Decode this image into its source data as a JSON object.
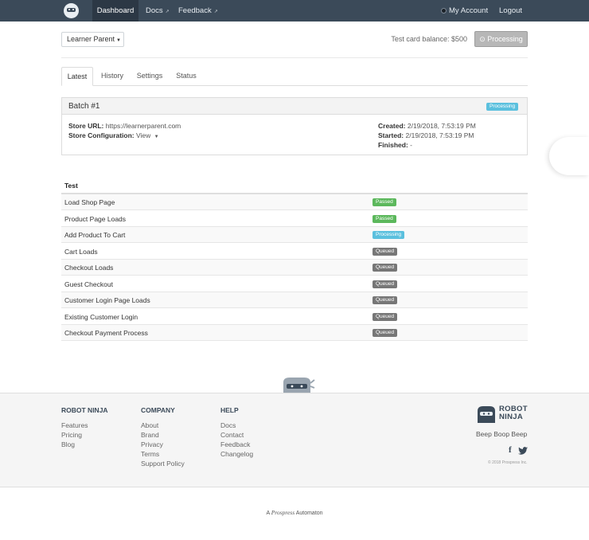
{
  "nav": {
    "items": [
      "Dashboard",
      "Docs",
      "Feedback"
    ],
    "external_marker": "↗",
    "account": "My Account",
    "logout": "Logout"
  },
  "toolbar": {
    "store": "Learner Parent",
    "balance": "Test card balance: $500",
    "status_button": "Processing"
  },
  "tabs": [
    "Latest",
    "History",
    "Settings",
    "Status"
  ],
  "batch": {
    "title": "Batch #1",
    "status": "Processing",
    "store_url_label": "Store URL:",
    "store_url": "https://learnerparent.com",
    "config_label": "Store Configuration:",
    "config_value": "View",
    "created_label": "Created:",
    "created": "2/19/2018, 7:53:19 PM",
    "started_label": "Started:",
    "started": "2/19/2018, 7:53:19 PM",
    "finished_label": "Finished:",
    "finished": "-"
  },
  "tests": {
    "header": "Test",
    "rows": [
      {
        "name": "Load Shop Page",
        "status": "Passed"
      },
      {
        "name": "Product Page Loads",
        "status": "Passed"
      },
      {
        "name": "Add Product To Cart",
        "status": "Processing"
      },
      {
        "name": "Cart Loads",
        "status": "Queued"
      },
      {
        "name": "Checkout Loads",
        "status": "Queued"
      },
      {
        "name": "Guest Checkout",
        "status": "Queued"
      },
      {
        "name": "Customer Login Page Loads",
        "status": "Queued"
      },
      {
        "name": "Existing Customer Login",
        "status": "Queued"
      },
      {
        "name": "Checkout Payment Process",
        "status": "Queued"
      }
    ]
  },
  "footer": {
    "robot_ninja": {
      "title": "ROBOT NINJA",
      "links": [
        "Features",
        "Pricing",
        "Blog"
      ]
    },
    "company": {
      "title": "COMPANY",
      "links": [
        "About",
        "Brand",
        "Privacy",
        "Terms",
        "Support Policy"
      ]
    },
    "help": {
      "title": "HELP",
      "links": [
        "Docs",
        "Contact",
        "Feedback",
        "Changelog"
      ]
    },
    "brand_line1": "ROBOT",
    "brand_line2": "NINJA",
    "tagline": "Beep Boop Beep",
    "copyright": "© 2018 Prospress Inc.",
    "credit_prefix": "A",
    "credit_brand": "Prospress",
    "credit_suffix": "Automaton"
  },
  "colors": {
    "nav_bg": "#3b4a59",
    "passed": "#5cb85c",
    "processing": "#5bc0de",
    "queued": "#777777"
  }
}
